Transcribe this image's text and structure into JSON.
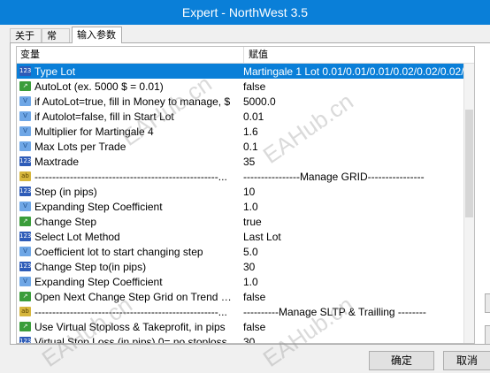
{
  "window": {
    "title": "Expert - NorthWest 3.5"
  },
  "tabs": [
    {
      "label": "关于"
    },
    {
      "label": "常用"
    },
    {
      "label": "输入参数"
    }
  ],
  "table": {
    "headers": {
      "name": "变量",
      "value": "赋值"
    },
    "rows": [
      {
        "icon": "123",
        "name": "Type Lot",
        "value": "Martingale 1 Lot 0.01/0.01/0.01/0.02/0.02/0.02/0..."
      },
      {
        "icon": "chart",
        "name": "AutoLot (ex. 5000 $ = 0.01)",
        "value": "false"
      },
      {
        "icon": "decimal",
        "name": "if AutoLot=true, fill in Money to manage, $",
        "value": "5000.0"
      },
      {
        "icon": "decimal",
        "name": "if Autolot=false, fill in Start Lot",
        "value": "0.01"
      },
      {
        "icon": "decimal",
        "name": "Multiplier for Martingale 4",
        "value": "1.6"
      },
      {
        "icon": "decimal",
        "name": "Max Lots per Trade",
        "value": "0.1"
      },
      {
        "icon": "123",
        "name": "Maxtrade",
        "value": "35"
      },
      {
        "icon": "ab",
        "name": "----------------------------------------------------...",
        "value": "----------------Manage GRID----------------"
      },
      {
        "icon": "123",
        "name": "Step (in pips)",
        "value": "10"
      },
      {
        "icon": "decimal",
        "name": "Expanding Step Coefficient",
        "value": "1.0"
      },
      {
        "icon": "chart",
        "name": "Change Step",
        "value": "true"
      },
      {
        "icon": "123",
        "name": "Select Lot Method",
        "value": "Last Lot"
      },
      {
        "icon": "decimal",
        "name": "Coefficient lot to start changing step",
        "value": "5.0"
      },
      {
        "icon": "123",
        "name": "Change Step to(in pips)",
        "value": "30"
      },
      {
        "icon": "decimal",
        "name": "Expanding Step Coefficient",
        "value": "1.0"
      },
      {
        "icon": "chart",
        "name": "Open Next Change Step Grid on Trend Direct...",
        "value": "false"
      },
      {
        "icon": "ab",
        "name": "----------------------------------------------------...",
        "value": "----------Manage SLTP & Trailling --------"
      },
      {
        "icon": "chart",
        "name": "Use Virtual Stoploss & Takeprofit, in pips",
        "value": "false"
      },
      {
        "icon": "123",
        "name": "Virtual Stop Loss (in pips),0= no stoploss",
        "value": "30"
      }
    ]
  },
  "buttons": {
    "ok": "确定",
    "cancel": "取消"
  },
  "watermark": "EAHub.cn",
  "colors": {
    "titlebar": "#0a7fd8",
    "selection": "#0a7fd8"
  }
}
